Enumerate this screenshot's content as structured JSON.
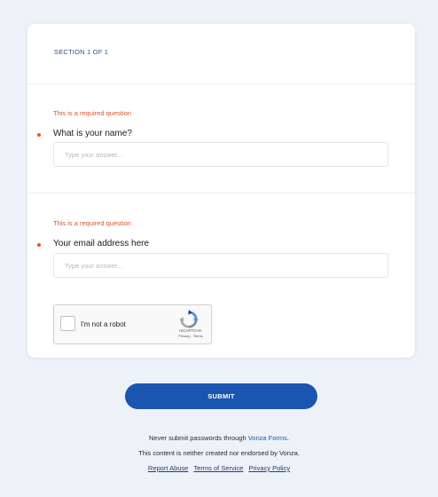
{
  "section": {
    "label": "SECTION 1 OF 1"
  },
  "questions": [
    {
      "error": "This is a required question",
      "title": "What is your name?",
      "placeholder": "Type your answer...",
      "value": ""
    },
    {
      "error": "This is a required question",
      "title": "Your email address here",
      "placeholder": "Type your answer...",
      "value": ""
    }
  ],
  "captcha": {
    "label": "I'm not a robot",
    "brand": "reCAPTCHA",
    "links": "Privacy - Terms"
  },
  "submit": {
    "label": "SUBMIT"
  },
  "footer": {
    "warning_prefix": "Never submit passwords through ",
    "warning_link": "Vonza Forms",
    "warning_suffix": ".",
    "disclaimer": "This content is neither created nor endorsed by Vonza.",
    "links": [
      "Report Abuse",
      "Terms of Service",
      "Privacy Policy"
    ]
  },
  "colors": {
    "accent": "#1a56b0",
    "error": "#d9542b",
    "background": "#edf2f9"
  }
}
